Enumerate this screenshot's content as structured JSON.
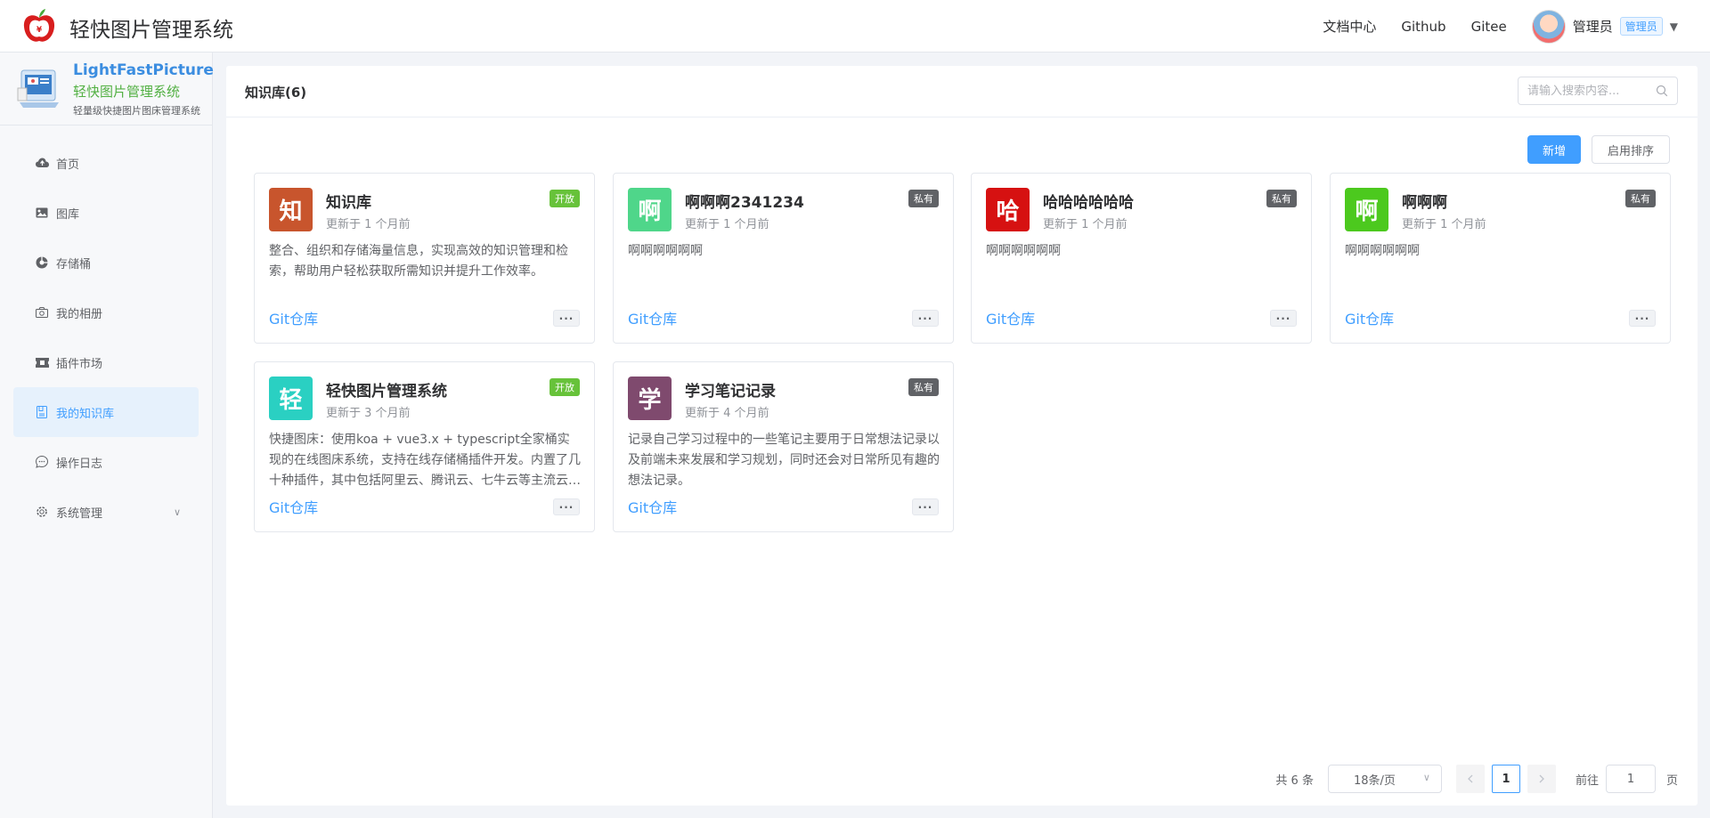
{
  "header": {
    "app_title": "轻快图片管理系统",
    "links": [
      "文档中心",
      "Github",
      "Gitee"
    ],
    "user_name": "管理员",
    "role_tag": "管理员"
  },
  "sidebar": {
    "brand_name": "LightFastPicture",
    "brand_sub": "轻快图片管理系统",
    "brand_desc": "轻量级快捷图片图床管理系统",
    "items": [
      {
        "label": "首页",
        "icon": "cloud-icon"
      },
      {
        "label": "图库",
        "icon": "image-icon"
      },
      {
        "label": "存储桶",
        "icon": "bucket-icon"
      },
      {
        "label": "我的相册",
        "icon": "camera-icon"
      },
      {
        "label": "插件市场",
        "icon": "ticket-icon"
      },
      {
        "label": "我的知识库",
        "icon": "notebook-icon",
        "active": true
      },
      {
        "label": "操作日志",
        "icon": "chat-icon"
      },
      {
        "label": "系统管理",
        "icon": "settings-icon",
        "expandable": true
      }
    ]
  },
  "main": {
    "title": "知识库(6)",
    "search_placeholder": "请输入搜索内容...",
    "add_label": "新增",
    "sort_label": "启用排序"
  },
  "cards": [
    {
      "icon_char": "知",
      "icon_color": "#c8552d",
      "title": "知识库",
      "time": "更新于 1 个月前",
      "badge": "开放",
      "badge_type": "open",
      "desc": "整合、组织和存储海量信息，实现高效的知识管理和检索，帮助用户轻松获取所需知识并提升工作效率。",
      "link": "Git仓库",
      "more": "···"
    },
    {
      "icon_char": "啊",
      "icon_color": "#4fd68a",
      "title": "啊啊啊2341234",
      "time": "更新于 1 个月前",
      "badge": "私有",
      "badge_type": "private",
      "desc": "啊啊啊啊啊啊",
      "link": "Git仓库",
      "more": "···"
    },
    {
      "icon_char": "哈",
      "icon_color": "#d61111",
      "title": "哈哈哈哈哈哈",
      "time": "更新于 1 个月前",
      "badge": "私有",
      "badge_type": "private",
      "desc": "啊啊啊啊啊啊",
      "link": "Git仓库",
      "more": "···"
    },
    {
      "icon_char": "啊",
      "icon_color": "#4cc91e",
      "title": "啊啊啊",
      "time": "更新于 1 个月前",
      "badge": "私有",
      "badge_type": "private",
      "desc": "啊啊啊啊啊啊",
      "link": "Git仓库",
      "more": "···"
    },
    {
      "icon_char": "轻",
      "icon_color": "#2ad0c2",
      "title": "轻快图片管理系统",
      "time": "更新于 3 个月前",
      "badge": "开放",
      "badge_type": "open",
      "desc": "快捷图床：使用koa + vue3.x + typescript全家桶实现的在线图床系统，支持在线存储桶插件开发。内置了几十种插件，其中包括阿里云、腾讯云、七牛云等主流云存储服务商。",
      "link": "Git仓库",
      "more": "···"
    },
    {
      "icon_char": "学",
      "icon_color": "#7f4a6e",
      "title": "学习笔记记录",
      "time": "更新于 4 个月前",
      "badge": "私有",
      "badge_type": "private",
      "desc": "记录自己学习过程中的一些笔记主要用于日常想法记录以及前端未来发展和学习规划，同时还会对日常所见有趣的想法记录。",
      "link": "Git仓库",
      "more": "···"
    }
  ],
  "pagination": {
    "total": "共 6 条",
    "page_size": "18条/页",
    "current_page": "1",
    "goto_label": "前往",
    "goto_value": "1",
    "page_suffix": "页"
  }
}
